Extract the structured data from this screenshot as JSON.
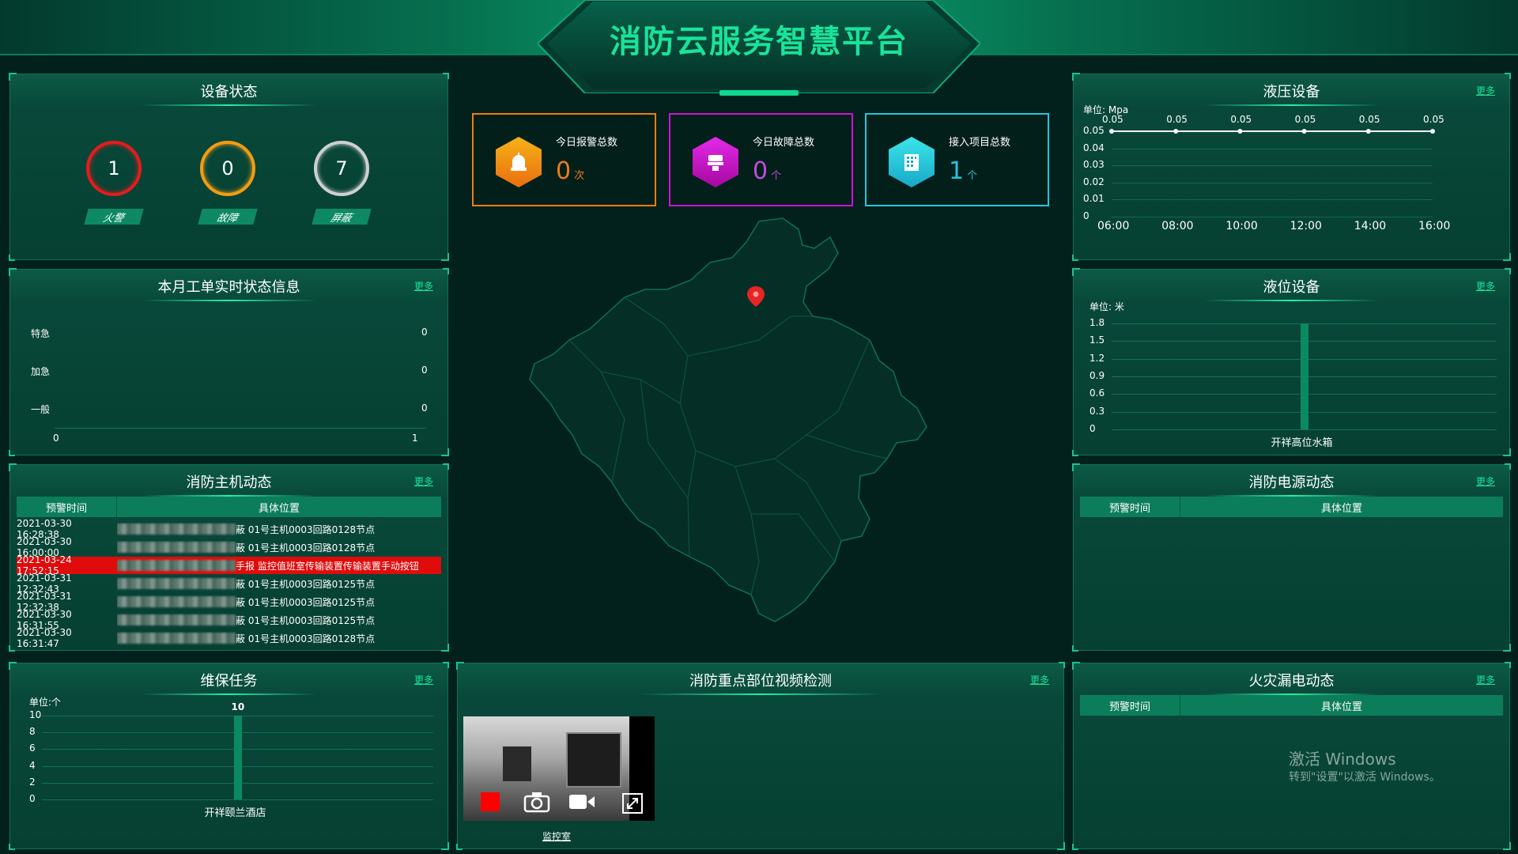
{
  "header": {
    "title": "消防云服务智慧平台"
  },
  "device_status": {
    "title": "设备状态",
    "items": [
      {
        "value": "1",
        "label": "火警",
        "color": "#e11d1d"
      },
      {
        "value": "0",
        "label": "故障",
        "color": "#f39c12"
      },
      {
        "value": "7",
        "label": "屏蔽",
        "color": "#cfcfcf"
      }
    ]
  },
  "work_orders": {
    "title": "本月工单实时状态信息",
    "more": "更多",
    "rows": [
      {
        "label": "特急",
        "value": "0"
      },
      {
        "label": "加急",
        "value": "0"
      },
      {
        "label": "一般",
        "value": "0"
      }
    ],
    "axis": [
      "0",
      "1"
    ]
  },
  "host_dynamics": {
    "title": "消防主机动态",
    "more": "更多",
    "headers": [
      "预警时间",
      "具体位置"
    ],
    "rows": [
      {
        "time": "2021-03-30 16:28:38",
        "location": "蔽 01号主机0003回路0128节点",
        "alert": false
      },
      {
        "time": "2021-03-30 16:00:00",
        "location": "蔽 01号主机0003回路0128节点",
        "alert": false
      },
      {
        "time": "2021-03-24 17:52:15",
        "location": "手报 监控值班室传输装置传输装置手动按钮",
        "alert": true
      },
      {
        "time": "2021-03-31 12:32:43",
        "location": "蔽 01号主机0003回路0125节点",
        "alert": false
      },
      {
        "time": "2021-03-31 12:32:38",
        "location": "蔽 01号主机0003回路0125节点",
        "alert": false
      },
      {
        "time": "2021-03-30 16:31:55",
        "location": "蔽 01号主机0003回路0125节点",
        "alert": false
      },
      {
        "time": "2021-03-30 16:31:47",
        "location": "蔽 01号主机0003回路0128节点",
        "alert": false
      }
    ]
  },
  "maintenance": {
    "title": "维保任务",
    "more": "更多",
    "unit": "单位:个",
    "chart_data": {
      "type": "bar",
      "categories": [
        "开祥颐兰酒店"
      ],
      "values": [
        10
      ],
      "ylim": [
        0,
        10
      ],
      "yticks": [
        0,
        2,
        4,
        6,
        8,
        10
      ],
      "data_labels": [
        "10"
      ]
    }
  },
  "stats": [
    {
      "label": "今日报警总数",
      "value": "0",
      "unit": "次",
      "color": "#f07c12",
      "icon": "alarm-icon"
    },
    {
      "label": "今日故障总数",
      "value": "0",
      "unit": "个",
      "color": "#d010d8",
      "icon": "fault-icon"
    },
    {
      "label": "接入项目总数",
      "value": "1",
      "unit": "个",
      "color": "#22c7e0",
      "icon": "building-icon"
    }
  ],
  "video": {
    "title": "消防重点部位视频检测",
    "more": "更多",
    "caption": "监控室"
  },
  "hydraulic": {
    "title": "液压设备",
    "more": "更多",
    "unit": "单位: Mpa",
    "chart_data": {
      "type": "line",
      "x": [
        "06:00",
        "08:00",
        "10:00",
        "12:00",
        "14:00",
        "16:00"
      ],
      "values": [
        0.05,
        0.05,
        0.05,
        0.05,
        0.05,
        0.05
      ],
      "data_labels": [
        "0.05",
        "0.05",
        "0.05",
        "0.05",
        "0.05",
        "0.05"
      ],
      "ylim": [
        0,
        0.05
      ],
      "yticks": [
        "0",
        "0.01",
        "0.02",
        "0.03",
        "0.04",
        "0.05"
      ]
    }
  },
  "liquid": {
    "title": "液位设备",
    "more": "更多",
    "unit": "单位: 米",
    "chart_data": {
      "type": "bar",
      "categories": [
        "开祥高位水箱"
      ],
      "values": [
        1.8
      ],
      "ylim": [
        0,
        1.8
      ],
      "yticks": [
        "0",
        "0.3",
        "0.6",
        "0.9",
        "1.2",
        "1.5",
        "1.8"
      ]
    }
  },
  "power": {
    "title": "消防电源动态",
    "more": "更多",
    "headers": [
      "预警时间",
      "具体位置"
    ]
  },
  "leakage": {
    "title": "火灾漏电动态",
    "more": "更多",
    "headers": [
      "预警时间",
      "具体位置"
    ]
  },
  "watermark": {
    "line1": "激活 Windows",
    "line2": "转到\"设置\"以激活 Windows。"
  }
}
